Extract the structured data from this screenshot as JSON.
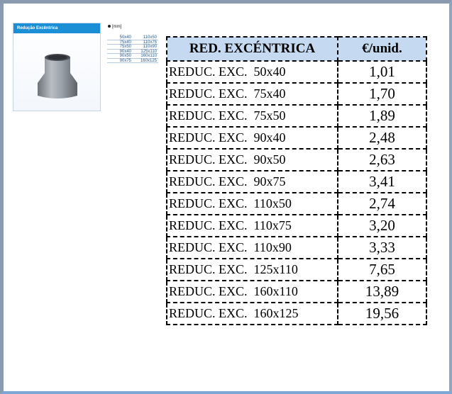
{
  "card": {
    "title": "Redução Excêntrica",
    "unit_label": "[mm]",
    "dimensions": [
      [
        "50x40",
        "110x50"
      ],
      [
        "75x40",
        "110x75"
      ],
      [
        "75x50",
        "110x90"
      ],
      [
        "90x40",
        "125x110"
      ],
      [
        "90x50",
        "160x110"
      ],
      [
        "90x75",
        "160x125"
      ]
    ]
  },
  "table": {
    "headers": [
      "RED. EXCÉNTRICA",
      "€/unid."
    ],
    "rows": [
      {
        "product": "REDUC. EXC.  50x40",
        "price": "1,01"
      },
      {
        "product": "REDUC. EXC.  75x40",
        "price": "1,70"
      },
      {
        "product": "REDUC. EXC.  75x50",
        "price": "1,89"
      },
      {
        "product": "REDUC. EXC.  90x40",
        "price": "2,48"
      },
      {
        "product": "REDUC. EXC.  90x50",
        "price": "2,63"
      },
      {
        "product": "REDUC. EXC.  90x75",
        "price": "3,41"
      },
      {
        "product": "REDUC. EXC.  110x50",
        "price": "2,74"
      },
      {
        "product": "REDUC. EXC.  110x75",
        "price": "3,20"
      },
      {
        "product": "REDUC. EXC.  110x90",
        "price": "3,33"
      },
      {
        "product": "REDUC. EXC.  125x110",
        "price": "7,65"
      },
      {
        "product": "REDUC. EXC.  160x110",
        "price": "13,89"
      },
      {
        "product": "REDUC. EXC.  160x125",
        "price": "19,56"
      }
    ]
  },
  "colors": {
    "header_bg": "#c5d9f1",
    "card_title_bg": "#1a8fd6",
    "frame": "#8a9bb0"
  }
}
